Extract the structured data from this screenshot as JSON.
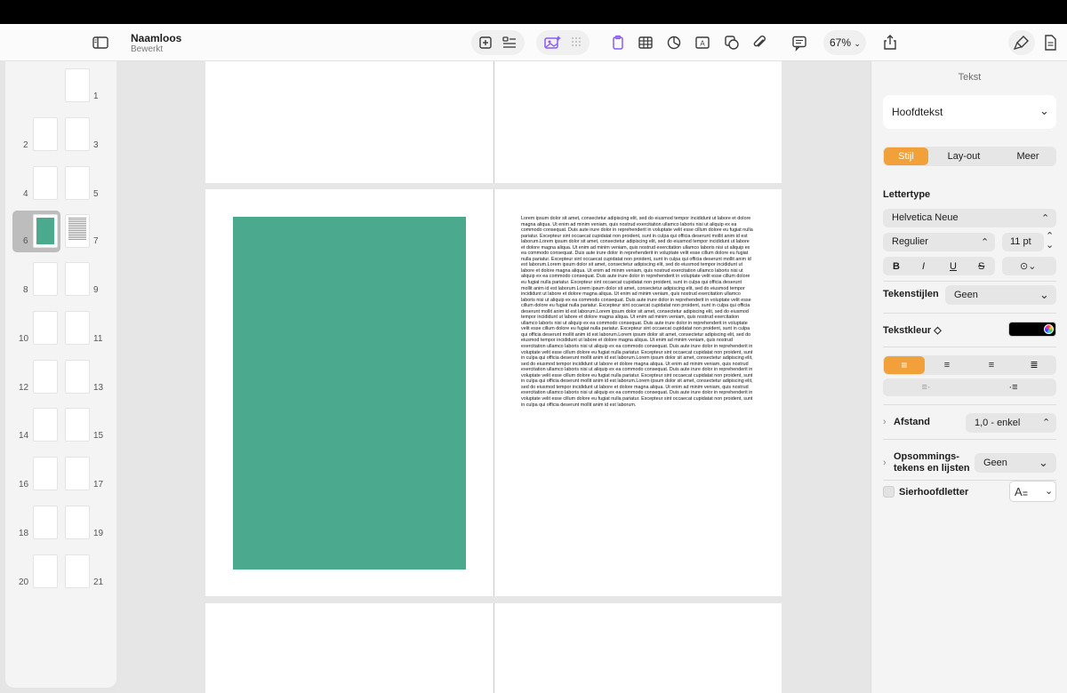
{
  "document": {
    "title": "Naamloos",
    "status": "Bewerkt"
  },
  "toolbar": {
    "zoom": "67%"
  },
  "thumbnails": {
    "labels": [
      "1",
      "2",
      "3",
      "4",
      "5",
      "6",
      "7",
      "8",
      "9",
      "10",
      "11",
      "12",
      "13",
      "14",
      "15",
      "16",
      "17",
      "18",
      "19",
      "20",
      "21"
    ]
  },
  "canvas": {
    "block_color": "#4BA98D",
    "body_text": "Lorem ipsum dolor sit amet, consectetur adipiscing elit, sed do eiusmod tempor incididunt ut labore et dolore magna aliqua. Ut enim ad minim veniam, quis nostrud exercitation ullamco laboris nisi ut aliquip ex ea commodo consequat. Duis aute irure dolor in reprehenderit in voluptate velit esse cillum dolore eu fugiat nulla pariatur. Excepteur sint occaecat cupidatat non proident, sunt in culpa qui officia deserunt mollit anim id est laborum.Lorem ipsum dolor sit amet, consectetur adipiscing elit, sed do eiusmod tempor incididunt ut labore et dolore magna aliqua. Ut enim ad minim veniam, quis nostrud exercitation ullamco laboris nisi ut aliquip ex ea commodo consequat. Duis aute irure dolor in reprehenderit in voluptate velit esse cillum dolore eu fugiat nulla pariatur. Excepteur sint occaecat cupidatat non proident, sunt in culpa qui officia deserunt mollit anim id est laborum.Lorem ipsum dolor sit amet, consectetur adipiscing elit, sed do eiusmod tempor incididunt ut labore et dolore magna aliqua. Ut enim ad minim veniam, quis nostrud exercitation ullamco laboris nisi ut aliquip ex ea commodo consequat. Duis aute irure dolor in reprehenderit in voluptate velit esse cillum dolore eu fugiat nulla pariatur. Excepteur sint occaecat cupidatat non proident, sunt in culpa qui officia deserunt mollit anim id est laborum.Lorem ipsum dolor sit amet, consectetur adipiscing elit, sed do eiusmod tempor incididunt ut labore et dolore magna aliqua. Ut enim ad minim veniam, quis nostrud exercitation ullamco laboris nisi ut aliquip ex ea commodo consequat. Duis aute irure dolor in reprehenderit in voluptate velit esse cillum dolore eu fugiat nulla pariatur. Excepteur sint occaecat cupidatat non proident, sunt in culpa qui officia deserunt mollit anim id est laborum.Lorem ipsum dolor sit amet, consectetur adipiscing elit, sed do eiusmod tempor incididunt ut labore et dolore magna aliqua. Ut enim ad minim veniam, quis nostrud exercitation ullamco laboris nisi ut aliquip ex ea commodo consequat. Duis aute irure dolor in reprehenderit in voluptate velit esse cillum dolore eu fugiat nulla pariatur. Excepteur sint occaecat cupidatat non proident, sunt in culpa qui officia deserunt mollit anim id est laborum.Lorem ipsum dolor sit amet, consectetur adipiscing elit, sed do eiusmod tempor incididunt ut labore et dolore magna aliqua. Ut enim ad minim veniam, quis nostrud exercitation ullamco laboris nisi ut aliquip ex ea commodo consequat. Duis aute irure dolor in reprehenderit in voluptate velit esse cillum dolore eu fugiat nulla pariatur. Excepteur sint occaecat cupidatat non proident, sunt in culpa qui officia deserunt mollit anim id est laborum.Lorem ipsum dolor sit amet, consectetur adipiscing elit, sed do eiusmod tempor incididunt ut labore et dolore magna aliqua. Ut enim ad minim veniam, quis nostrud exercitation ullamco laboris nisi ut aliquip ex ea commodo consequat. Duis aute irure dolor in reprehenderit in voluptate velit esse cillum dolore eu fugiat nulla pariatur. Excepteur sint occaecat cupidatat non proident, sunt in culpa qui officia deserunt mollit anim id est laborum.Lorem ipsum dolor sit amet, consectetur adipiscing elit, sed do eiusmod tempor incididunt ut labore et dolore magna aliqua. Ut enim ad minim veniam, quis nostrud exercitation ullamco laboris nisi ut aliquip ex ea commodo consequat. Duis aute irure dolor in reprehenderit in voluptate velit esse cillum dolore eu fugiat nulla pariatur. Excepteur sint occaecat cupidatat non proident, sunt in culpa qui officia deserunt mollit anim id est laborum."
  },
  "inspector": {
    "header": "Tekst",
    "paragraph_style": "Hoofdtekst",
    "tabs": {
      "style": "Stijl",
      "layout": "Lay-out",
      "more": "Meer"
    },
    "font_section": "Lettertype",
    "font_family": "Helvetica Neue",
    "font_weight": "Regulier",
    "font_size": "11 pt",
    "format_buttons": {
      "bold": "B",
      "italic": "I",
      "underline": "U",
      "strike": "S"
    },
    "character_styles_label": "Tekenstijlen",
    "character_styles_value": "Geen",
    "text_color_label": "Tekstkleur ◇",
    "text_color": "#000000",
    "accent_color": "#F1A03A",
    "spacing_label": "Afstand",
    "spacing_value": "1,0 - enkel",
    "bullets_label_line1": "Opsommings-",
    "bullets_label_line2": "tekens en lijsten",
    "bullets_value": "Geen",
    "dropcap_label": "Sierhoofdletter"
  }
}
